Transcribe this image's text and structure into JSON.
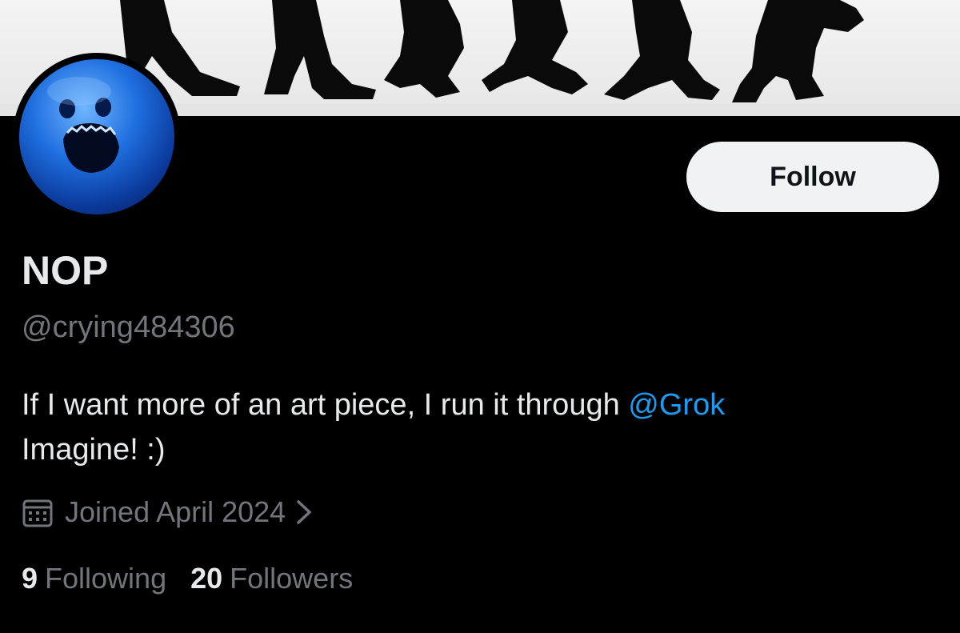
{
  "profile": {
    "display_name": "NOP",
    "handle": "@crying484306",
    "bio_text": "If I want more of an art piece, I run it through ",
    "bio_mention": "@Grok",
    "bio_text_end": "Imagine! :)",
    "joined": "Joined April 2024",
    "following_count": "9",
    "following_label": "Following",
    "followers_count": "20",
    "followers_label": "Followers"
  },
  "actions": {
    "follow_label": "Follow"
  },
  "icons": {
    "calendar": "calendar-icon",
    "chevron": "chevron-right-icon"
  },
  "colors": {
    "background": "#000000",
    "primary_text": "#e7e9ea",
    "secondary_text": "#71767b",
    "link": "#1d9bf0",
    "follow_button": "#eff3f4"
  }
}
